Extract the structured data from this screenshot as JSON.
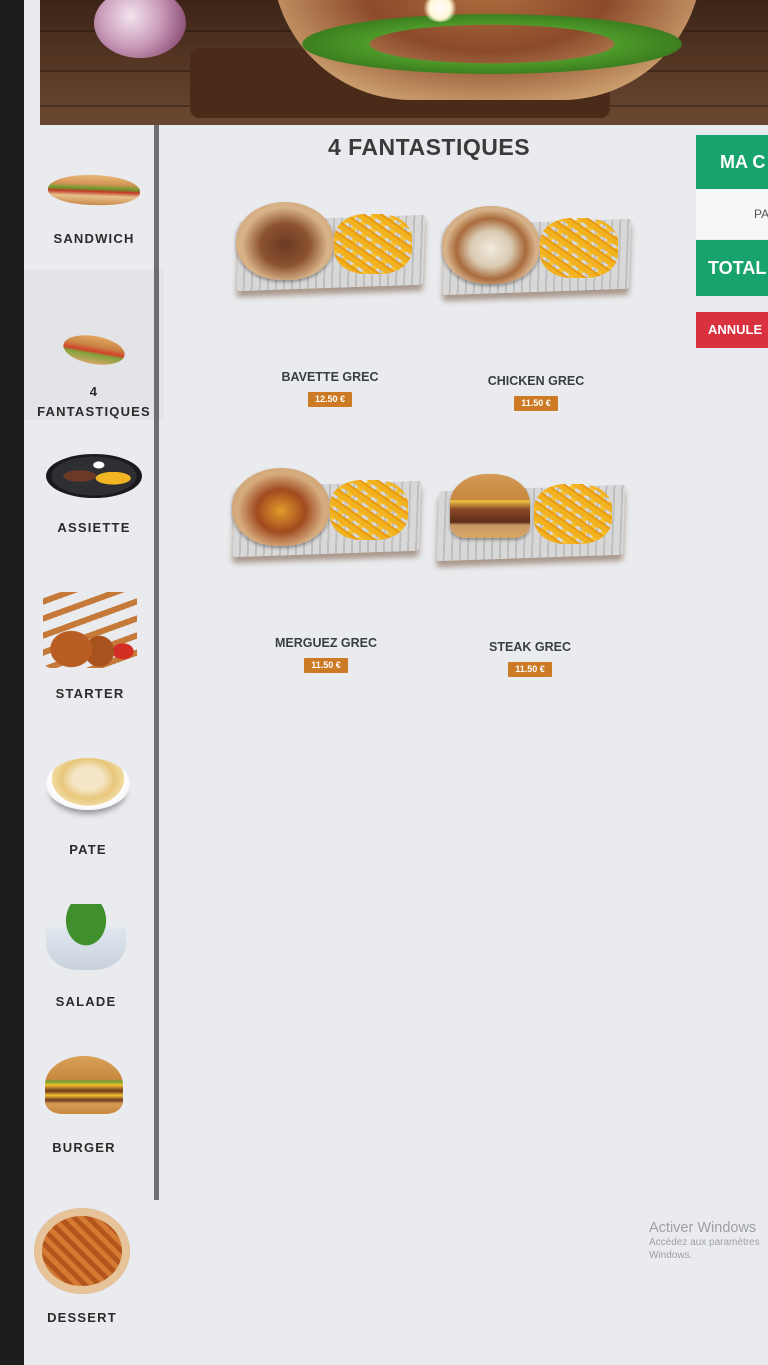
{
  "category_header": {
    "title": "4 FANTASTIQUES"
  },
  "sidebar": {
    "items": [
      {
        "label": "SANDWICH"
      },
      {
        "label": "4\nFANTASTIQUES",
        "active": true
      },
      {
        "label": "ASSIETTE"
      },
      {
        "label": "STARTER"
      },
      {
        "label": "PATE"
      },
      {
        "label": "SALADE"
      },
      {
        "label": "BURGER"
      },
      {
        "label": "DESSERT"
      }
    ]
  },
  "products": [
    {
      "name": "BAVETTE GREC",
      "price": "12.50 €"
    },
    {
      "name": "CHICKEN GREC",
      "price": "11.50 €"
    },
    {
      "name": "MERGUEZ GREC",
      "price": "11.50 €"
    },
    {
      "name": "STEAK GREC",
      "price": "11.50 €"
    }
  ],
  "cart": {
    "header": "MA C",
    "sub": "PA",
    "total_label": "TOTAL",
    "cancel_label": "ANNULE"
  },
  "watermark": {
    "title": "Activer Windows",
    "line1": "Accédez aux paramètres",
    "line2": "Windows."
  },
  "colors": {
    "accent_green": "#17a36b",
    "cancel_red": "#d9313d",
    "price_orange": "#cc7a24",
    "background": "#e9ebee"
  }
}
